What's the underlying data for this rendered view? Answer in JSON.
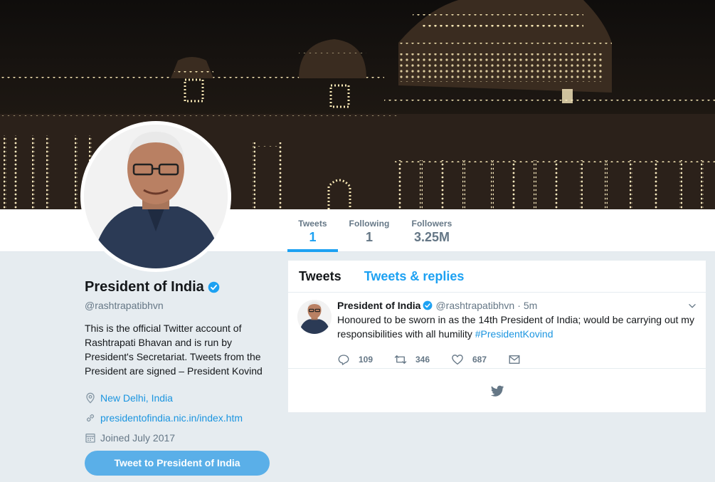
{
  "profile": {
    "name": "President of India",
    "handle": "@rashtrapatibhvn",
    "bio": "This is the official Twitter account of Rashtrapati Bhavan and is run by President's Secretariat. Tweets from the President are signed – President Kovind",
    "location": "New Delhi, India",
    "website": "presidentofindia.nic.in/index.htm",
    "joined": "Joined July 2017",
    "tweet_to_label": "Tweet to President of India"
  },
  "nav": {
    "stats": [
      {
        "label": "Tweets",
        "value": "1"
      },
      {
        "label": "Following",
        "value": "1"
      },
      {
        "label": "Followers",
        "value": "3.25M"
      }
    ]
  },
  "timeline": {
    "tabs": [
      {
        "label": "Tweets"
      },
      {
        "label": "Tweets & replies"
      }
    ],
    "tweet": {
      "name": "President of India",
      "handle": "@rashtrapatibhvn",
      "separator": "·",
      "time": "5m",
      "text": "Honoured to be sworn in as the 14th President of India; would be carrying out my responsibilities with all humility",
      "hashtag": "#PresidentKovind",
      "replies": "109",
      "retweets": "346",
      "likes": "687"
    }
  },
  "colors": {
    "accent": "#1da1f2",
    "link": "#1b95e0",
    "button": "#5aafe8",
    "background": "#e6ecf0",
    "muted": "#657786"
  },
  "icons": [
    "verified-badge-icon",
    "location-pin-icon",
    "link-icon",
    "calendar-icon",
    "reply-icon",
    "retweet-icon",
    "like-heart-icon",
    "direct-message-icon",
    "chevron-down-icon",
    "twitter-bird-icon"
  ]
}
